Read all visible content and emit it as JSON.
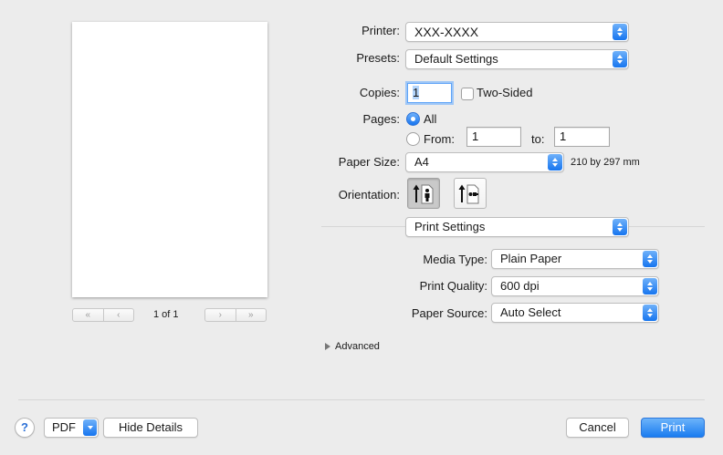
{
  "preview": {
    "page_count": "1 of 1",
    "nav_first": "«",
    "nav_prev": "‹",
    "nav_next": "›",
    "nav_last": "»"
  },
  "printer": {
    "label": "Printer:",
    "value": "XXX-XXXX"
  },
  "presets": {
    "label": "Presets:",
    "value": "Default Settings"
  },
  "copies": {
    "label": "Copies:",
    "value": "1",
    "two_sided_label": "Two-Sided",
    "two_sided_checked": false
  },
  "pages": {
    "label": "Pages:",
    "all_label": "All",
    "from_label": "From:",
    "from_value": "1",
    "to_label": "to:",
    "to_value": "1",
    "selected": "All"
  },
  "paper_size": {
    "label": "Paper Size:",
    "value": "A4",
    "dimensions": "210 by 297 mm"
  },
  "orientation": {
    "label": "Orientation:",
    "selected": "portrait"
  },
  "section": {
    "value": "Print Settings"
  },
  "media_type": {
    "label": "Media Type:",
    "value": "Plain Paper"
  },
  "print_quality": {
    "label": "Print Quality:",
    "value": "600 dpi"
  },
  "paper_source": {
    "label": "Paper Source:",
    "value": "Auto Select"
  },
  "advanced": {
    "label": "Advanced"
  },
  "footer": {
    "help": "?",
    "pdf": "PDF",
    "hide_details": "Hide Details",
    "cancel": "Cancel",
    "print": "Print"
  },
  "colors": {
    "accent": "#1a7cf0",
    "background": "#ececec"
  }
}
